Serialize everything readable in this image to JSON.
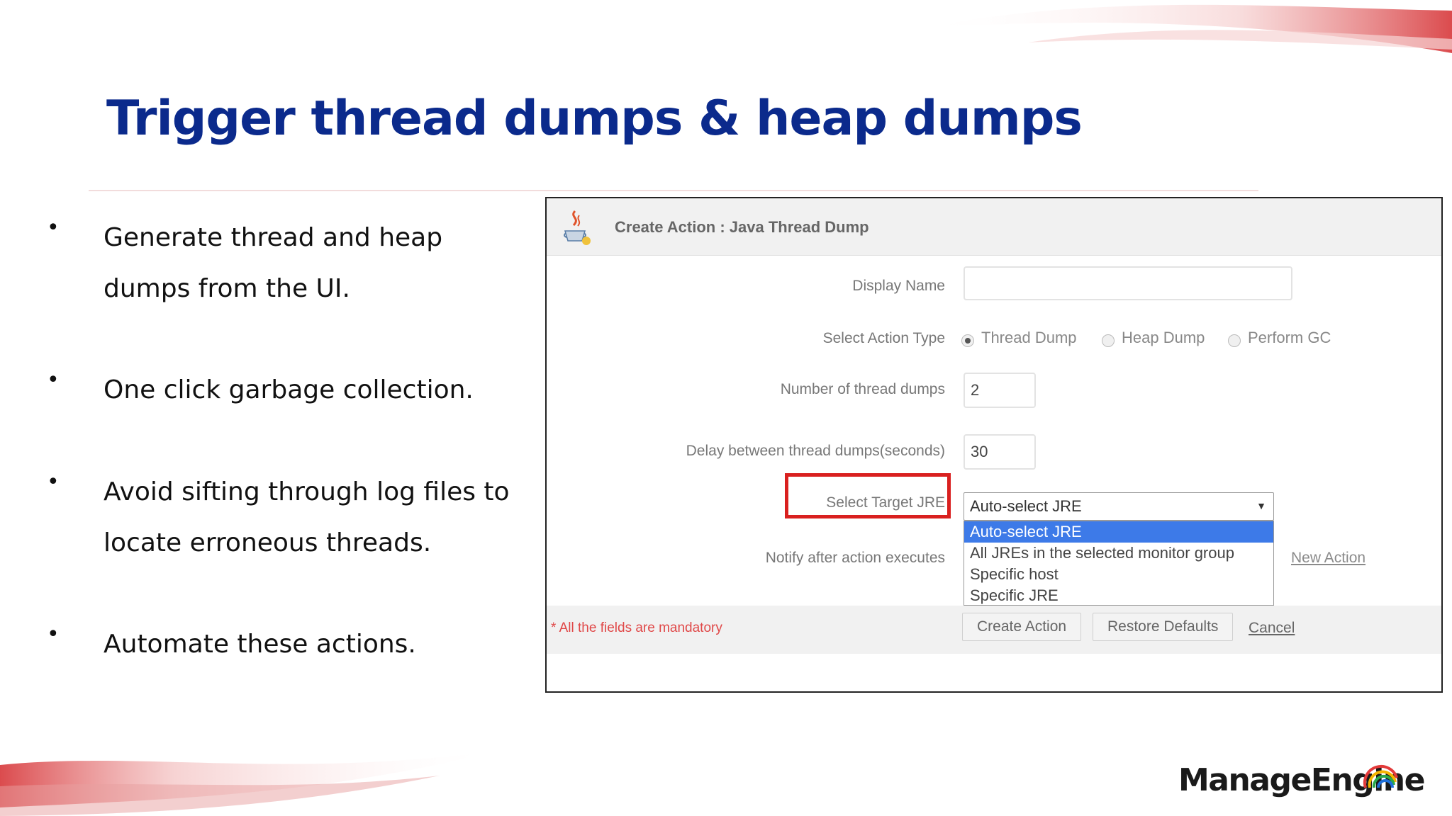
{
  "slide": {
    "title": "Trigger thread dumps & heap dumps",
    "bullets": [
      "Generate thread and heap dumps from the UI.",
      "One click garbage collection.",
      "Avoid sifting through log files to locate erroneous threads.",
      "Automate these actions."
    ],
    "bullet_marker": "•",
    "colors": {
      "title": "#0b2a8c",
      "accent": "#d9201f"
    }
  },
  "dialog": {
    "title": "Create Action : Java Thread Dump",
    "icon": "java-cup-icon",
    "fields": {
      "display_name": {
        "label": "Display Name",
        "value": ""
      },
      "action_type": {
        "label": "Select Action Type",
        "options": [
          "Thread Dump",
          "Heap Dump",
          "Perform GC"
        ],
        "selected": "Thread Dump"
      },
      "thread_dump_count": {
        "label": "Number of thread dumps",
        "value": "2"
      },
      "delay": {
        "label": "Delay between thread dumps(seconds)",
        "value": "30"
      },
      "target_jre": {
        "label": "Select Target JRE",
        "value": "Auto-select JRE",
        "options": [
          "Auto-select JRE",
          "All JREs in the selected monitor group",
          "Specific host",
          "Specific JRE"
        ],
        "highlighted_option": "Auto-select JRE"
      },
      "notify": {
        "label": "Notify after action executes",
        "link": "New Action"
      }
    },
    "footer": {
      "mandatory_note": "* All the fields are mandatory",
      "create_button": "Create Action",
      "restore_button": "Restore Defaults",
      "cancel_link": "Cancel"
    },
    "colors": {
      "highlight_box": "#d9201f",
      "selected_option_bg": "#3d7ae8"
    }
  },
  "brand": {
    "logo_text": "ManageEngine",
    "logo_icon": "rainbow-arcs-icon"
  }
}
